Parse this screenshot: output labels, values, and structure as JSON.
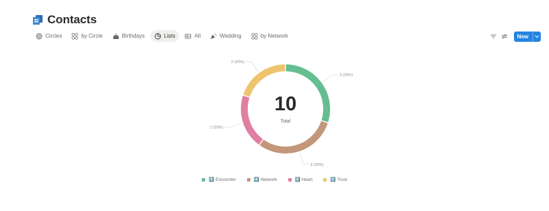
{
  "page": {
    "title": "Contacts",
    "icon": "contacts-book-icon",
    "accent": "#2383e2"
  },
  "tabs": [
    {
      "label": "Circles",
      "icon": "target-icon",
      "active": false
    },
    {
      "label": "by Circle",
      "icon": "grid-circles-icon",
      "active": false
    },
    {
      "label": "Birthdays",
      "icon": "cake-icon",
      "active": false
    },
    {
      "label": "Lists",
      "icon": "pie-chart-icon",
      "active": true
    },
    {
      "label": "All",
      "icon": "table-icon",
      "active": false
    },
    {
      "label": "Wedding",
      "icon": "party-icon",
      "active": false
    },
    {
      "label": "by Network",
      "icon": "grid-circles-icon",
      "active": false
    }
  ],
  "toolbar": {
    "filter_icon": "filter-icon",
    "settings_icon": "sliders-icon",
    "new_label": "New",
    "new_dropdown_icon": "chevron-down-icon"
  },
  "chart_data": {
    "type": "pie",
    "donut": true,
    "center_value": "10",
    "center_label": "Total",
    "categories": [
      "Encounter",
      "Network",
      "Heart",
      "Trust"
    ],
    "values": [
      3,
      3,
      2,
      2
    ],
    "labels": [
      "3 (30%)",
      "3 (30%)",
      "2 (20%)",
      "2 (20%)"
    ],
    "colors": [
      "#65bd91",
      "#c2977a",
      "#e07fa3",
      "#eec46f"
    ],
    "legend_position": "bottom",
    "legend": [
      {
        "label": "Encounter",
        "prefix": "3️⃣",
        "color": "#65bd91"
      },
      {
        "label": "Network",
        "prefix": "4️⃣",
        "color": "#c2977a"
      },
      {
        "label": "Heart",
        "prefix": "5️⃣",
        "color": "#e07fa3"
      },
      {
        "label": "Trust",
        "prefix": "2️⃣",
        "color": "#eec46f"
      }
    ]
  }
}
